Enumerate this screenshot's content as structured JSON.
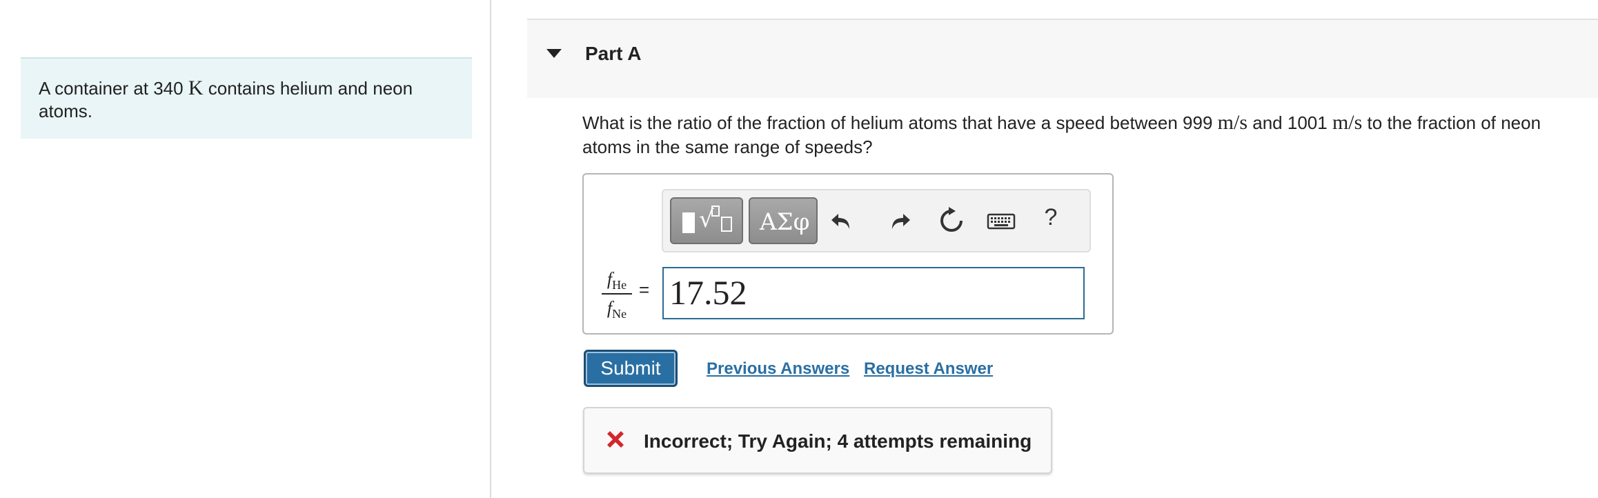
{
  "problem": {
    "prefix": "A container at 340",
    "unit": "K",
    "suffix": "contains helium and neon atoms."
  },
  "part": {
    "title": "Part A"
  },
  "question": {
    "text1": "What is the ratio of the fraction of helium atoms that have a speed between 999",
    "unit1": "m/s",
    "text2": "and 1001",
    "unit2": "m/s",
    "text3": "to the fraction of neon atoms in the same range of speeds?"
  },
  "toolbar": {
    "greek_label": "ΑΣφ",
    "help_label": "?"
  },
  "answer": {
    "numerator": "f",
    "numerator_sub": "He",
    "denominator": "f",
    "denominator_sub": "Ne",
    "equals": "=",
    "value": "17.52"
  },
  "actions": {
    "submit_label": "Submit",
    "previous_answers_label": "Previous Answers",
    "request_answer_label": "Request Answer"
  },
  "feedback": {
    "text": "Incorrect; Try Again; 4 attempts remaining",
    "icon": "x-icon",
    "color": "#d0282e"
  },
  "colors": {
    "accent": "#2a6fa3",
    "problem_bg": "#e9f5f6"
  }
}
